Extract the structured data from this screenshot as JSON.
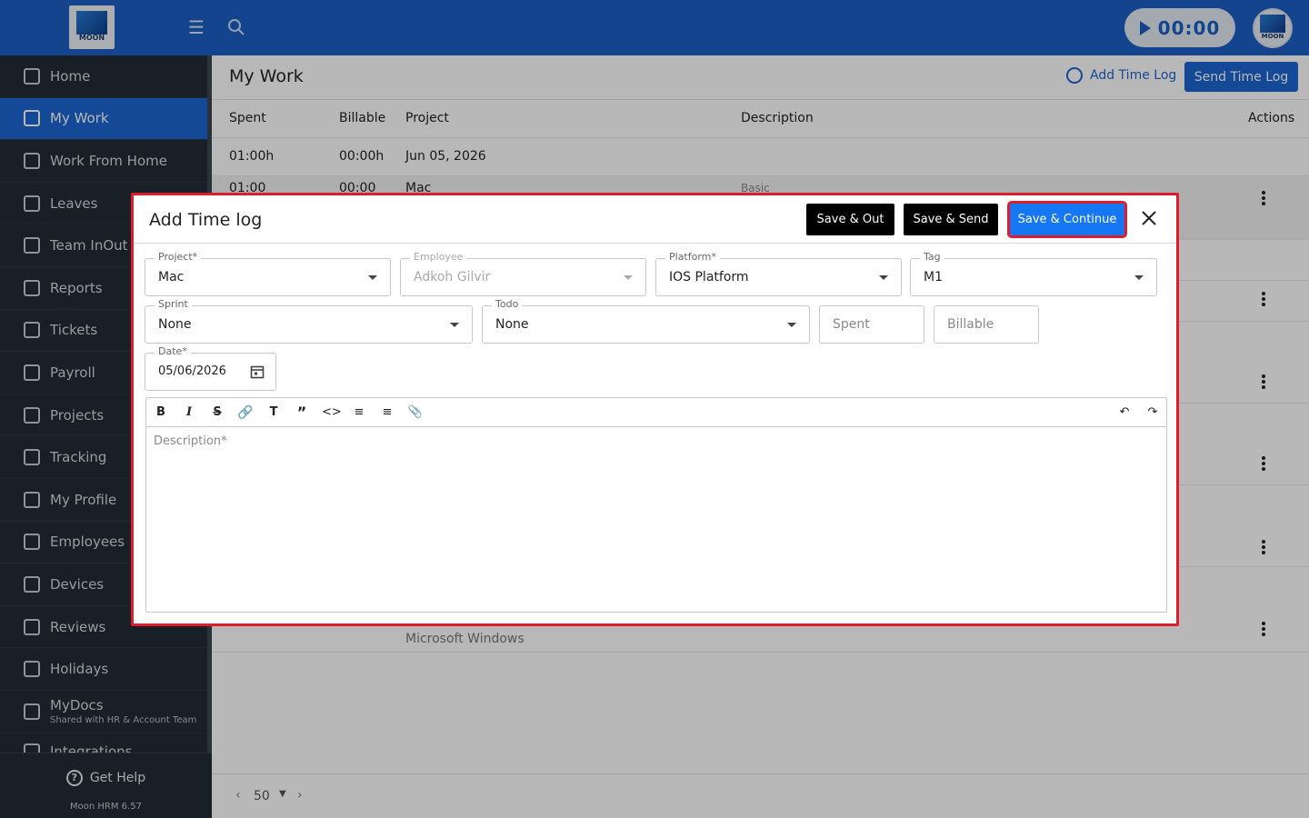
{
  "topbar": {
    "logo_text": "MOON",
    "timer": "00:00",
    "avatar_text": "MOON"
  },
  "sidebar": {
    "items": [
      {
        "label": "Home",
        "icon": "home-icon"
      },
      {
        "label": "My Work",
        "icon": "briefcase-icon",
        "active": true
      },
      {
        "label": "Work From Home",
        "icon": "home-work-icon"
      },
      {
        "label": "Leaves",
        "icon": "calendar-icon"
      },
      {
        "label": "Team InOut",
        "icon": "team-icon"
      },
      {
        "label": "Reports",
        "icon": "report-icon"
      },
      {
        "label": "Tickets",
        "icon": "ticket-icon"
      },
      {
        "label": "Payroll",
        "icon": "payroll-icon"
      },
      {
        "label": "Projects",
        "icon": "projects-icon"
      },
      {
        "label": "Tracking",
        "icon": "tracking-icon"
      },
      {
        "label": "My Profile",
        "icon": "profile-icon"
      },
      {
        "label": "Employees",
        "icon": "employees-icon"
      },
      {
        "label": "Devices",
        "icon": "devices-icon"
      },
      {
        "label": "Reviews",
        "icon": "reviews-icon"
      },
      {
        "label": "Holidays",
        "icon": "holidays-icon"
      },
      {
        "label": "MyDocs",
        "icon": "folder-icon",
        "sub": "Shared with HR & Account Team"
      },
      {
        "label": "Integrations",
        "icon": "integrations-icon"
      }
    ],
    "get_help": "Get Help",
    "version": "Moon HRM 6.57"
  },
  "main": {
    "title": "My Work",
    "add_time_log": "Add Time Log",
    "send_time_log": "Send Time Log",
    "columns": {
      "spent": "Spent",
      "billable": "Billable",
      "project": "Project",
      "description": "Description",
      "actions": "Actions"
    },
    "group_row": {
      "spent": "01:00h",
      "billable": "00:00h",
      "project": "Jun 05, 2026"
    },
    "row1": {
      "spent": "01:00",
      "billable": "00:00",
      "project": "Mac",
      "description": "Basic"
    },
    "last_row": {
      "project": "Microsoft Windows"
    },
    "pagination": {
      "page_size": "50"
    }
  },
  "modal": {
    "title": "Add Time log",
    "buttons": {
      "save_out": "Save & Out",
      "save_send": "Save & Send",
      "save_continue": "Save & Continue"
    },
    "fields": {
      "project": {
        "label": "Project*",
        "value": "Mac"
      },
      "employee": {
        "label": "Employee",
        "value": "Adkoh Gilvir"
      },
      "platform": {
        "label": "Platform*",
        "value": "IOS Platform"
      },
      "tag": {
        "label": "Tag",
        "value": "M1"
      },
      "sprint": {
        "label": "Sprint",
        "value": "None"
      },
      "todo": {
        "label": "Todo",
        "value": "None"
      },
      "spent": {
        "placeholder": "Spent"
      },
      "billable": {
        "placeholder": "Billable"
      },
      "date": {
        "label": "Date*",
        "value": "05/06/2026"
      }
    },
    "editor": {
      "placeholder": "Description*",
      "toolbar": [
        "bold-icon",
        "italic-icon",
        "strikethrough-icon",
        "link-icon",
        "text-size-icon",
        "quote-icon",
        "code-icon",
        "bullet-list-icon",
        "numbered-list-icon",
        "attachment-icon",
        "undo-icon",
        "redo-icon"
      ]
    }
  },
  "colors": {
    "topbar": "#1c5fc4",
    "sidebar": "#222b35",
    "accent": "#1c66d1",
    "highlight": "#e01b2c"
  }
}
